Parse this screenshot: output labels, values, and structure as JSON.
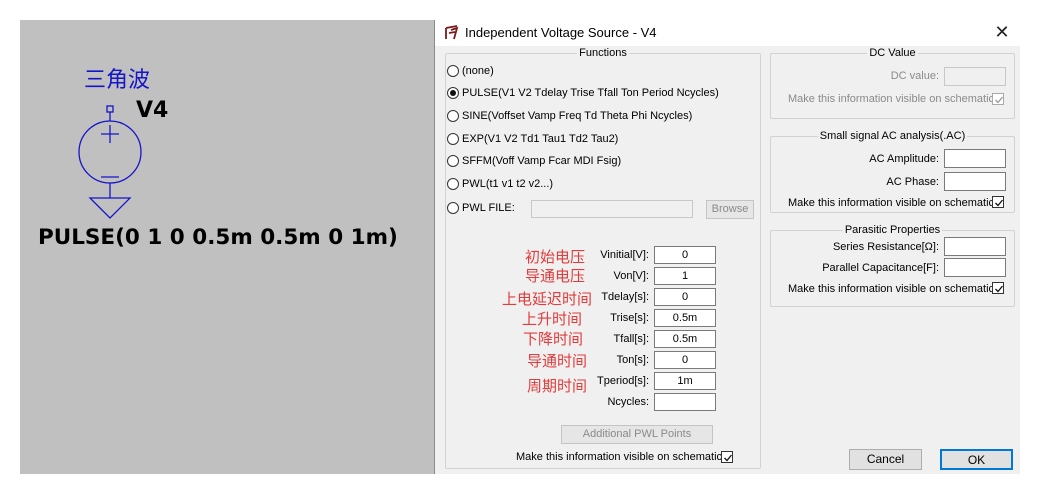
{
  "schematic": {
    "annotation_cn": "三角波",
    "component_name": "V4",
    "pulse_value": "PULSE(0 1 0 0.5m 0.5m 0 1m)"
  },
  "dialog": {
    "title": "Independent Voltage Source - V4",
    "functions": {
      "legend": "Functions",
      "options": [
        {
          "label": "(none)",
          "selected": false
        },
        {
          "label": "PULSE(V1 V2 Tdelay Trise Tfall Ton Period Ncycles)",
          "selected": true
        },
        {
          "label": "SINE(Voffset Vamp Freq Td Theta Phi Ncycles)",
          "selected": false
        },
        {
          "label": "EXP(V1 V2 Td1 Tau1 Td2 Tau2)",
          "selected": false
        },
        {
          "label": "SFFM(Voff Vamp Fcar MDI Fsig)",
          "selected": false
        },
        {
          "label": "PWL(t1 v1 t2 v2...)",
          "selected": false
        },
        {
          "label": "PWL FILE:",
          "selected": false
        }
      ],
      "browse_label": "Browse",
      "params": [
        {
          "anno": "初始电压",
          "label": "Vinitial[V]:",
          "value": "0"
        },
        {
          "anno": "导通电压",
          "label": "Von[V]:",
          "value": "1"
        },
        {
          "anno": "上电延迟时间",
          "label": "Tdelay[s]:",
          "value": "0"
        },
        {
          "anno": "上升时间",
          "label": "Trise[s]:",
          "value": "0.5m"
        },
        {
          "anno": "下降时间",
          "label": "Tfall[s]:",
          "value": "0.5m"
        },
        {
          "anno": "导通时间",
          "label": "Ton[s]:",
          "value": "0"
        },
        {
          "anno": "周期时间",
          "label": "Tperiod[s]:",
          "value": "1m"
        },
        {
          "anno": "",
          "label": "Ncycles:",
          "value": ""
        }
      ],
      "additional_pwl_label": "Additional PWL Points",
      "visible_label": "Make this information visible on schematic:",
      "visible_checked": true
    },
    "dc_value": {
      "legend": "DC Value",
      "dc_label": "DC value:",
      "dc_value": "",
      "visible_label": "Make this information visible on schematic:",
      "visible_checked": true
    },
    "ac_analysis": {
      "legend": "Small signal AC analysis(.AC)",
      "amplitude_label": "AC Amplitude:",
      "amplitude_value": "",
      "phase_label": "AC Phase:",
      "phase_value": "",
      "visible_label": "Make this information visible on schematic:",
      "visible_checked": true
    },
    "parasitic": {
      "legend": "Parasitic Properties",
      "series_label": "Series Resistance[Ω]:",
      "series_value": "",
      "parallel_label": "Parallel Capacitance[F]:",
      "parallel_value": "",
      "visible_label": "Make this information visible on schematic:",
      "visible_checked": true
    },
    "cancel_label": "Cancel",
    "ok_label": "OK"
  },
  "colors": {
    "schematic_bg": "#c0c0c0",
    "annotation_blue": "#1515c9",
    "annotation_red": "#e23b3b",
    "dialog_bg": "#f0f0f0",
    "ok_border": "#0078d7"
  }
}
